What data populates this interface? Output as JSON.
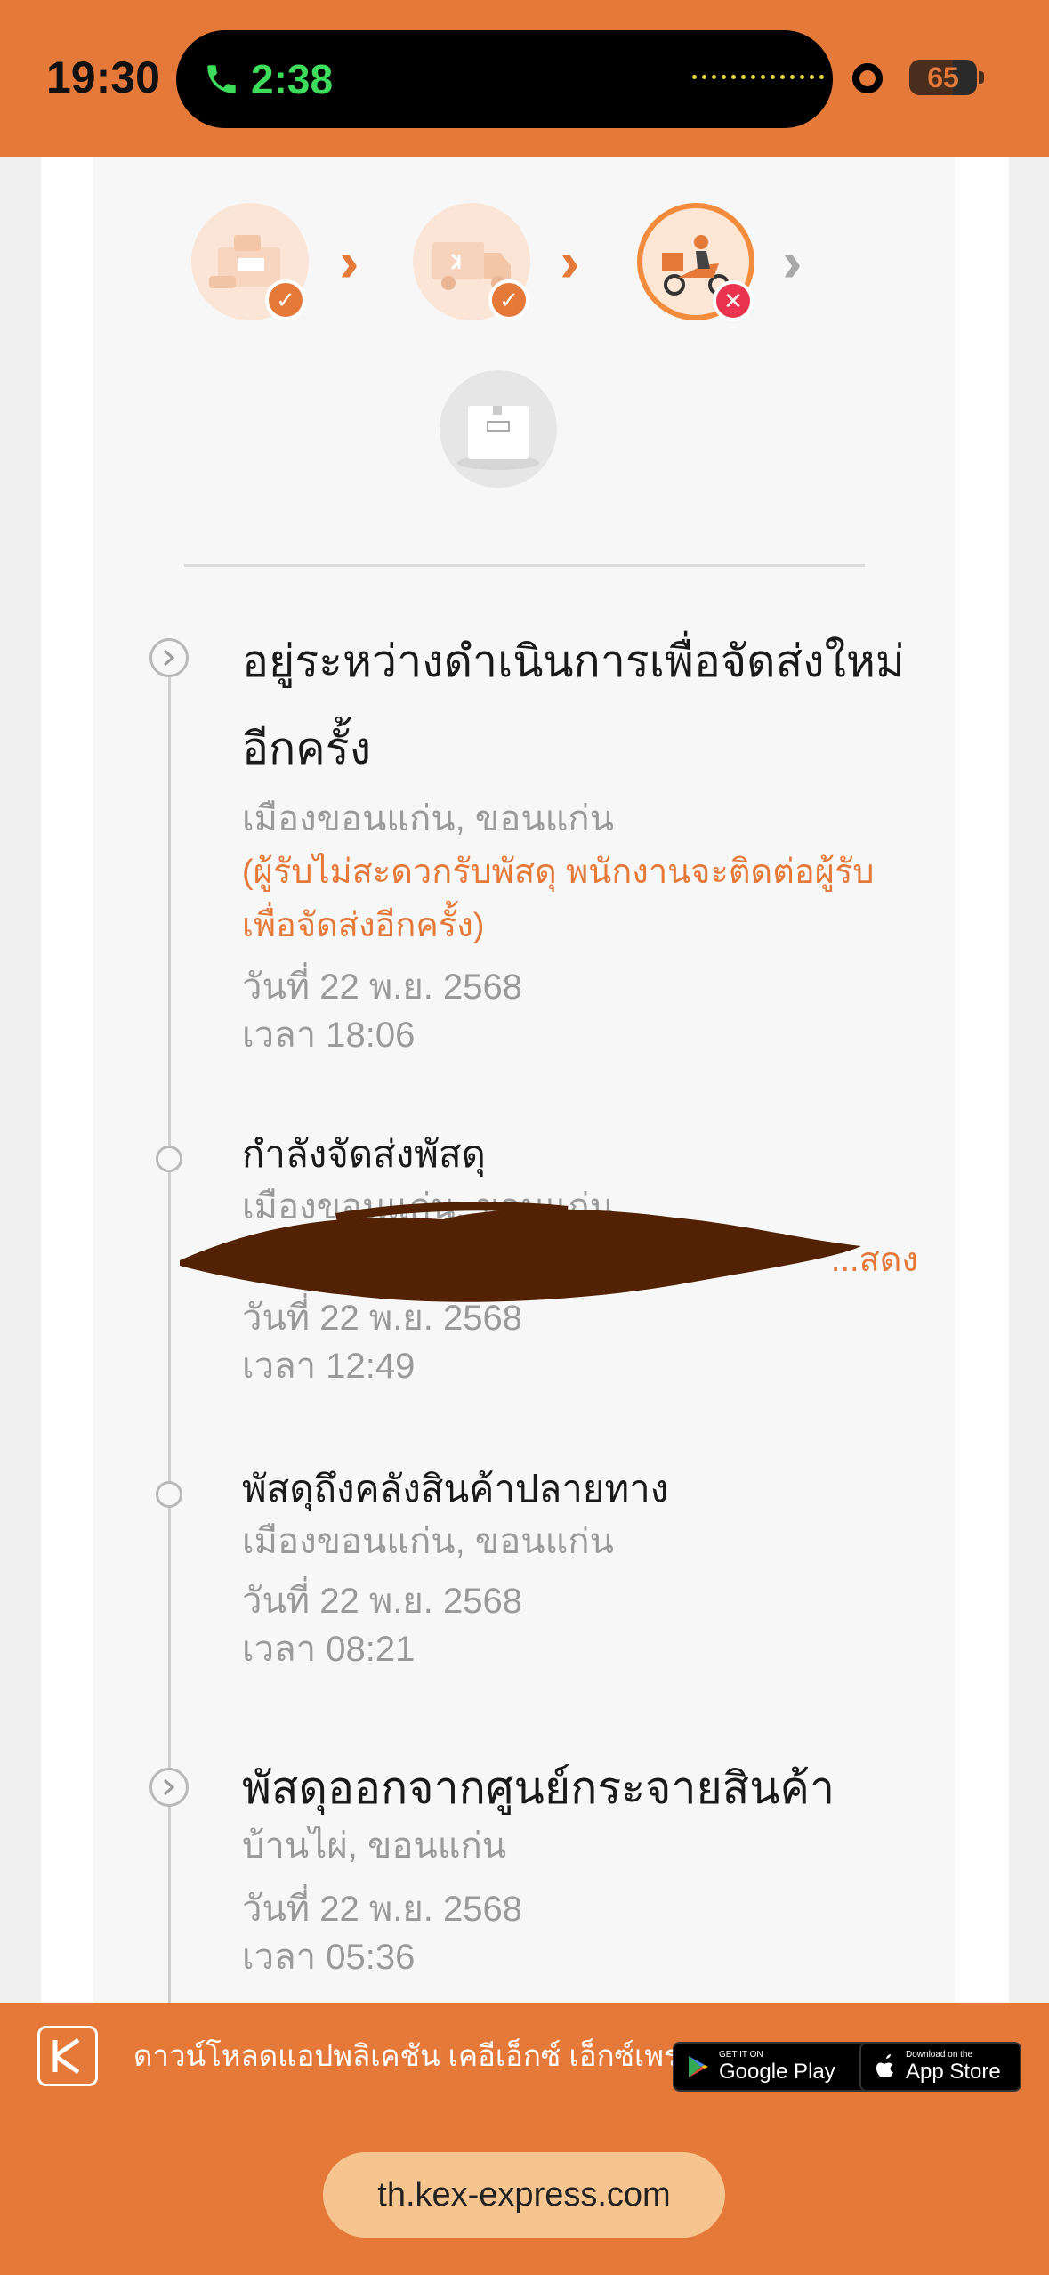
{
  "status_bar": {
    "time": "19:30",
    "call_duration": "2:38",
    "battery_level": "65",
    "battery_fraction": 0.65
  },
  "progress": {
    "steps": [
      {
        "name": "pickup",
        "status": "done"
      },
      {
        "name": "in-transit",
        "status": "done"
      },
      {
        "name": "out-for-delivery",
        "status": "failed"
      },
      {
        "name": "delivered",
        "status": "pending"
      }
    ]
  },
  "timeline": [
    {
      "title": "อยู่ระหว่างดำเนินการเพื่อจัดส่งใหม่อีกครั้ง",
      "location": "เมืองขอนแก่น, ขอนแก่น",
      "note": "(ผู้รับไม่สะดวกรับพัสดุ พนักงานจะติดต่อผู้รับเพื่อจัดส่งอีกครั้ง)",
      "date": "วันที่ 22 พ.ย. 2568",
      "time": "เวลา 18:06"
    },
    {
      "title": "กำลังจัดส่งพัสดุ",
      "location": "เมืองขอนแก่น, ขอนแก่น",
      "note": "...สดง",
      "date": "วันที่ 22 พ.ย. 2568",
      "time": "เวลา 12:49"
    },
    {
      "title": "พัสดุถึงคลังสินค้าปลายทาง",
      "location": "เมืองขอนแก่น, ขอนแก่น",
      "date": "วันที่ 22 พ.ย. 2568",
      "time": "เวลา 08:21"
    },
    {
      "title": "พัสดุออกจากศูนย์กระจายสินค้า",
      "location": "บ้านไผ่, ขอนแก่น",
      "date": "วันที่ 22 พ.ย. 2568",
      "time": "เวลา 05:36"
    }
  ],
  "footer": {
    "download_text": "ดาวน์โหลดแอปพลิเคชัน เคอีเอ็กซ์ เอ็กซ์เพรส",
    "google_play_small": "GET IT ON",
    "google_play_big": "Google Play",
    "app_store_small": "Download on the",
    "app_store_big": "App Store",
    "url": "th.kex-express.com"
  },
  "colors": {
    "brand_orange": "#e4793a",
    "error_red": "#e8324e"
  }
}
